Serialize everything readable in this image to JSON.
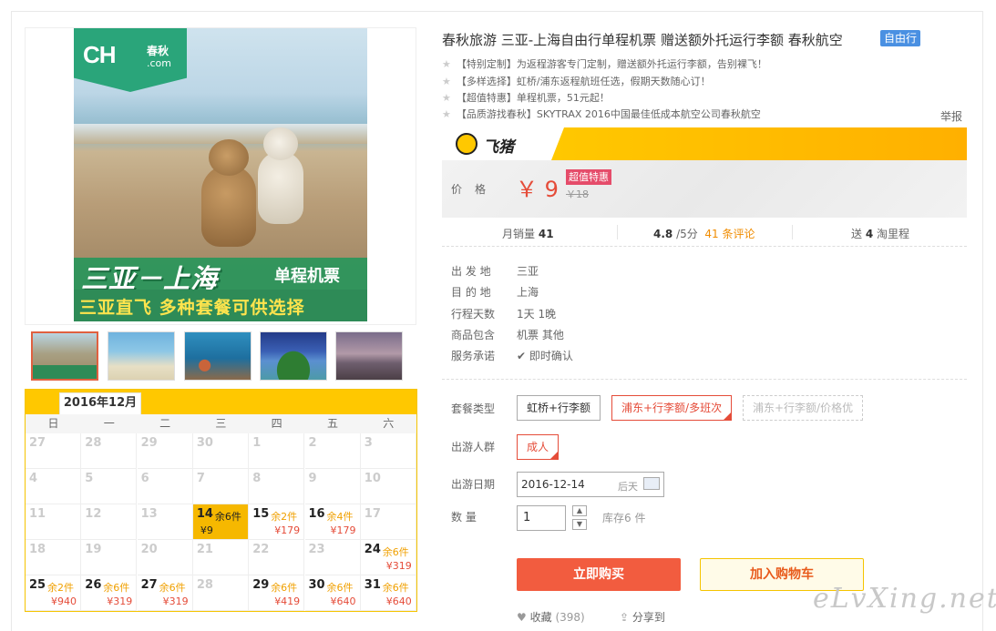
{
  "main_image": {
    "logo_text": "CH",
    "logo_cn": "春秋",
    "logo_com": ".com",
    "banner_route": "三亚－上海",
    "banner_type": "单程机票",
    "banner_sub": "三亚直飞 多种套餐可供选择"
  },
  "calendar": {
    "month": "2016年12月",
    "weekdays": [
      "日",
      "一",
      "二",
      "三",
      "四",
      "五",
      "六"
    ],
    "rows": [
      [
        {
          "d": "27"
        },
        {
          "d": "28"
        },
        {
          "d": "29"
        },
        {
          "d": "30"
        },
        {
          "d": "1"
        },
        {
          "d": "2"
        },
        {
          "d": "3"
        }
      ],
      [
        {
          "d": "4"
        },
        {
          "d": "5"
        },
        {
          "d": "6"
        },
        {
          "d": "7"
        },
        {
          "d": "8"
        },
        {
          "d": "9"
        },
        {
          "d": "10"
        }
      ],
      [
        {
          "d": "11"
        },
        {
          "d": "12"
        },
        {
          "d": "13"
        },
        {
          "d": "14",
          "s": "余6件",
          "p": "¥9",
          "sel": true
        },
        {
          "d": "15",
          "s": "余2件",
          "p": "¥179"
        },
        {
          "d": "16",
          "s": "余4件",
          "p": "¥179"
        },
        {
          "d": "17"
        }
      ],
      [
        {
          "d": "18"
        },
        {
          "d": "19"
        },
        {
          "d": "20"
        },
        {
          "d": "21"
        },
        {
          "d": "22"
        },
        {
          "d": "23"
        },
        {
          "d": "24",
          "s": "余6件",
          "p": "¥319"
        }
      ],
      [
        {
          "d": "25",
          "s": "余2件",
          "p": "¥940"
        },
        {
          "d": "26",
          "s": "余6件",
          "p": "¥319"
        },
        {
          "d": "27",
          "s": "余6件",
          "p": "¥319"
        },
        {
          "d": "28"
        },
        {
          "d": "29",
          "s": "余6件",
          "p": "¥419"
        },
        {
          "d": "30",
          "s": "余6件",
          "p": "¥640"
        },
        {
          "d": "31",
          "s": "余6件",
          "p": "¥640"
        }
      ]
    ]
  },
  "product": {
    "title": "春秋旅游 三亚-上海自由行单程机票 赠送额外托运行李额 春秋航空",
    "tag": "自由行",
    "features": [
      "【特别定制】为返程游客专门定制，赠送额外托运行李额，告别裸飞！",
      "【多样选择】虹桥/浦东返程航班任选，假期天数随心订！",
      "【超值特惠】单程机票，51元起！",
      "【品质游找春秋】SKYTRAX 2016中国最佳低成本航空公司春秋航空"
    ],
    "report": "举报",
    "platform": "飞猪"
  },
  "price": {
    "label": "价格",
    "current": "￥ 9",
    "badge": "超值特惠",
    "original": "￥18"
  },
  "stats": {
    "sales_label": "月销量",
    "sales": "41",
    "rating": "4.8",
    "rating_suffix": " /5分",
    "reviews": "41 条评论",
    "mileage_pre": "送",
    "mileage": "4",
    "mileage_suf": "淘里程"
  },
  "info": [
    {
      "k": "出 发 地",
      "v": "三亚"
    },
    {
      "k": "目 的 地",
      "v": "上海"
    },
    {
      "k": "行程天数",
      "v": "1天 1晚"
    },
    {
      "k": "商品包含",
      "v": "机票  其他"
    },
    {
      "k": "服务承诺",
      "v": "即时确认"
    }
  ],
  "options": {
    "package_label": "套餐类型",
    "packages": [
      "虹桥+行李额",
      "浦东+行李额/多班次",
      "浦东+行李额/价格优"
    ],
    "people_label": "出游人群",
    "people": "成人",
    "date_label": "出游日期",
    "date": "2016-12-14",
    "date_suffix": "后天",
    "qty_label": "数  量",
    "qty": "1",
    "stock": "库存6 件"
  },
  "actions": {
    "buy": "立即购买",
    "cart": "加入购物车",
    "fav": "收藏",
    "fav_count": "(398)",
    "share": "分享到"
  },
  "watermark": "eLvXing.net",
  "colors": {
    "accent": "#e54c39",
    "yellow": "#ffc800",
    "green": "#2aa57a",
    "tag_blue": "#4a90e2"
  }
}
